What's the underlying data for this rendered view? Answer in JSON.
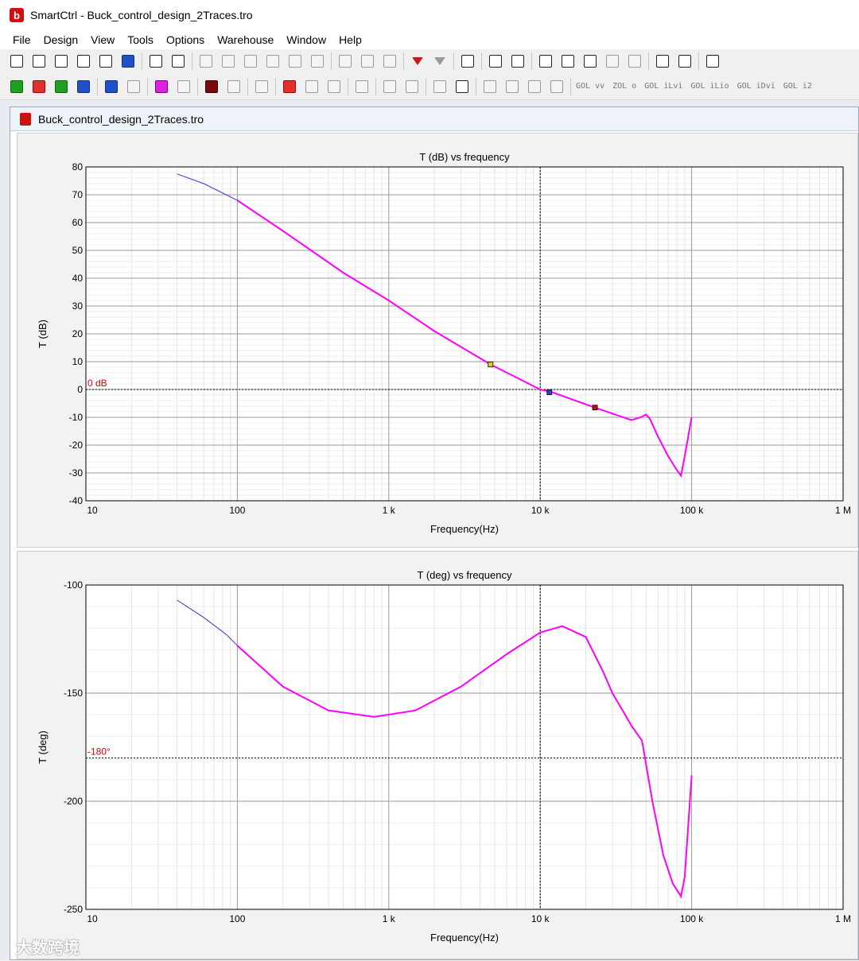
{
  "window": {
    "title": "SmartCtrl - Buck_control_design_2Traces.tro",
    "icon": "smartctrl-app-icon"
  },
  "menu": [
    "File",
    "Design",
    "View",
    "Tools",
    "Options",
    "Warehouse",
    "Window",
    "Help"
  ],
  "toolbar2_labels": [
    "GOL vv",
    "ZOL o",
    "GOL iLvi",
    "GOL iLio",
    "GOL iDvi",
    "GOL i2"
  ],
  "document": {
    "title": "Buck_control_design_2Traces.tro"
  },
  "colors": {
    "trace_primary": "#ff00ff",
    "trace_secondary": "#3333dd",
    "reference_line": "#dd0000"
  },
  "chart_data": [
    {
      "type": "line",
      "title": "T (dB) vs frequency",
      "xlabel": "Frequency(Hz)",
      "ylabel": "T (dB)",
      "xscale": "log",
      "xlim": [
        10,
        1000000
      ],
      "ylim": [
        -40,
        80
      ],
      "x_tick_labels": [
        "10",
        "100",
        "1 k",
        "10 k",
        "100 k",
        "1 M"
      ],
      "y_tick_labels": [
        "80",
        "70",
        "60",
        "50",
        "40",
        "30",
        "20",
        "10",
        "0",
        "-10",
        "-20",
        "-30",
        "-40"
      ],
      "reference_label": "0 dB",
      "reference_value": 0,
      "cursor_x": 10000,
      "grid": true,
      "series": [
        {
          "x": [
            40,
            60,
            100,
            200,
            500,
            1000,
            2000,
            4700,
            10000,
            12000,
            23000,
            40000,
            46000,
            50000,
            53000,
            60000,
            70000,
            80000,
            85000,
            90000,
            100000
          ],
          "y": [
            77.5,
            74,
            68,
            57,
            42,
            32,
            21,
            9,
            0,
            -1,
            -6.5,
            -11,
            -10,
            -9,
            -10.5,
            -17,
            -24,
            -29,
            -31,
            -24,
            -10
          ]
        }
      ],
      "markers": [
        {
          "x": 4700,
          "y": 9
        },
        {
          "x": 11500,
          "y": -1
        },
        {
          "x": 23000,
          "y": -6.5
        }
      ]
    },
    {
      "type": "line",
      "title": "T (deg) vs frequency",
      "xlabel": "Frequency(Hz)",
      "ylabel": "T (deg)",
      "xscale": "log",
      "xlim": [
        10,
        1000000
      ],
      "ylim": [
        -250,
        -100
      ],
      "x_tick_labels": [
        "10",
        "100",
        "1 k",
        "10 k",
        "100 k",
        "1 M"
      ],
      "y_tick_labels": [
        "-100",
        "-150",
        "-200",
        "-250"
      ],
      "reference_label": "-180°",
      "reference_value": -180,
      "cursor_x": 10000,
      "grid": true,
      "series": [
        {
          "x": [
            40,
            60,
            85,
            100,
            200,
            400,
            800,
            1500,
            3000,
            6000,
            10000,
            14000,
            20000,
            26000,
            30000,
            35000,
            40000,
            47000,
            55000,
            65000,
            75000,
            85000,
            90000,
            100000
          ],
          "y": [
            -107,
            -115,
            -123,
            -128,
            -147,
            -158,
            -161,
            -158,
            -147,
            -132,
            -122,
            -119,
            -124,
            -140,
            -150,
            -158,
            -165,
            -172,
            -200,
            -225,
            -238,
            -244,
            -235,
            -188
          ]
        }
      ]
    }
  ]
}
